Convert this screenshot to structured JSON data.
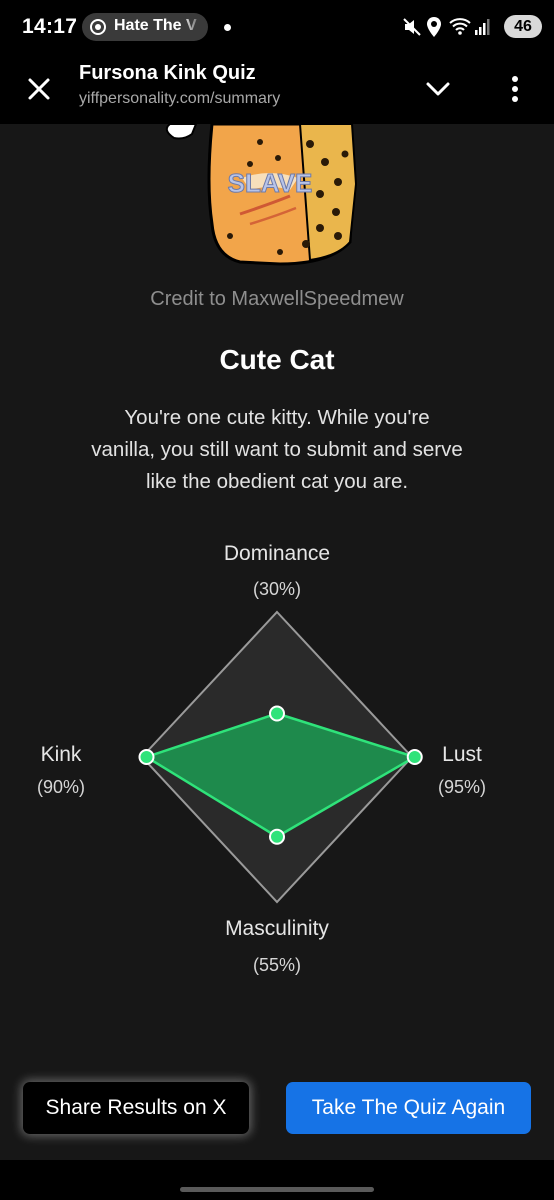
{
  "status": {
    "time": "14:17",
    "media_text": "Hate The V",
    "battery": "46"
  },
  "browser": {
    "title": "Fursona Kink Quiz",
    "url": "yiffpersonality.com/summary"
  },
  "result": {
    "credit": "Credit to MaxwellSpeedmew",
    "title": "Cute Cat",
    "description": "You're one cute kitty. While you're vanilla, you still want to submit and serve like the obedient cat you are.",
    "image_text": "SLAVE"
  },
  "chart_data": {
    "type": "radar",
    "axes": [
      {
        "name": "Dominance",
        "value": 30,
        "label": "(30%)"
      },
      {
        "name": "Lust",
        "value": 95,
        "label": "(95%)"
      },
      {
        "name": "Masculinity",
        "value": 55,
        "label": "(55%)"
      },
      {
        "name": "Kink",
        "value": 90,
        "label": "(90%)"
      }
    ],
    "range": [
      0,
      100
    ],
    "fill_color": "#1e8a4c",
    "line_color": "#2fe37a"
  },
  "buttons": {
    "share": "Share Results on X",
    "retake": "Take The Quiz Again"
  }
}
